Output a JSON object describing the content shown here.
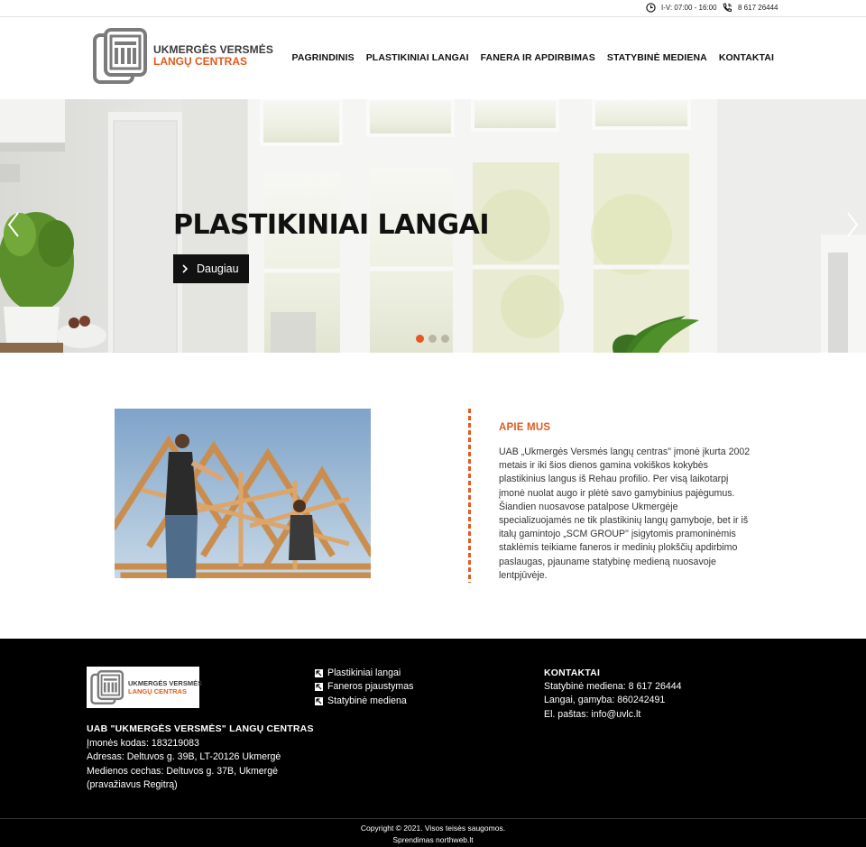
{
  "topbar": {
    "hours_icon": "clock-icon",
    "hours": "I-V: 07:00 - 16:00",
    "phone_icon": "phone-icon",
    "phone": "8 617 26444"
  },
  "logo": {
    "line1": "UKMERGĖS VERSMĖS",
    "line2": "LANGŲ CENTRAS"
  },
  "nav": {
    "items": [
      {
        "label": "PAGRINDINIS"
      },
      {
        "label": "PLASTIKINIAI LANGAI"
      },
      {
        "label": "FANERA IR APDIRBIMAS"
      },
      {
        "label": "STATYBINĖ MEDIENA"
      },
      {
        "label": "KONTAKTAI"
      }
    ]
  },
  "hero": {
    "title": "PLASTIKINIAI LANGAI",
    "button_label": "Daugiau",
    "slides_total": 3,
    "active_slide": 1,
    "colors": {
      "accent": "#e05a1e"
    }
  },
  "about": {
    "title": "APIE MUS",
    "text": "UAB „Ukmergės Versmės langų centras\" įmonė įkurta 2002 metais ir iki šios dienos gamina vokiškos kokybės plastikinius langus iš Rehau profilio. Per visą laikotarpį įmonė nuolat augo ir plėtė savo gamybinius pajėgumus. Šiandien nuosavose patalpose Ukmergėje specializuojamės ne tik plastikinių langų gamyboje, bet ir iš italų gamintojo „SCM GROUP\" įsigytomis pramoninėmis staklėmis teikiame faneros ir medinių plokščių apdirbimo paslaugas, pjauname statybinę medieną nuosavoje lentpjūvėje."
  },
  "footer": {
    "logo_line1": "UKMERGĖS VERSMĖS",
    "logo_line2": "LANGŲ CENTRAS",
    "company": "UAB \"UKMERGĖS VERSMĖS\" LANGŲ CENTRAS",
    "lines": [
      "Įmonės kodas: 183219083",
      "Adresas: Deltuvos g. 39B, LT-20126 Ukmergė",
      "Medienos cechas: Deltuvos g. 37B, Ukmergė",
      "(pravažiavus Regitrą)"
    ],
    "links": [
      "Plastikiniai langai",
      "Faneros pjaustymas",
      "Statybinė mediena"
    ],
    "contacts_title": "KONTAKTAI",
    "contacts": [
      "Statybinė mediena: 8 617 26444",
      "Langai, gamyba: 860242491",
      "El. paštas: info@uvlc.lt"
    ],
    "copyright": "Copyright © 2021. Visos teisės saugomos.",
    "credit": "Sprendimas northweb.lt"
  }
}
